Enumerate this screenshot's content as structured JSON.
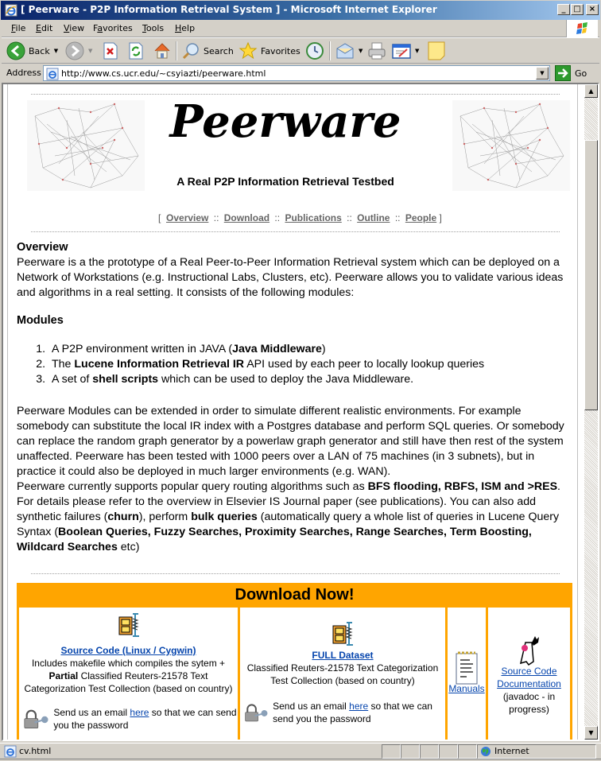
{
  "window": {
    "title": "[ Peerware - P2P Information Retrieval System ] - Microsoft Internet Explorer",
    "minimize": "_",
    "maximize": "□",
    "close": "×"
  },
  "menu": {
    "items": [
      {
        "label": "File",
        "accel": "F"
      },
      {
        "label": "Edit",
        "accel": "E"
      },
      {
        "label": "View",
        "accel": "V"
      },
      {
        "label": "Favorites",
        "accel": "a"
      },
      {
        "label": "Tools",
        "accel": "T"
      },
      {
        "label": "Help",
        "accel": "H"
      }
    ]
  },
  "toolbar": {
    "back_label": "Back",
    "search_label": "Search",
    "favorites_label": "Favorites",
    "icons": [
      "back-icon",
      "forward-icon",
      "stop-icon",
      "refresh-icon",
      "home-icon",
      "search-icon",
      "favorites-star-icon",
      "history-icon",
      "mail-icon",
      "print-icon",
      "edit-icon",
      "notes-icon"
    ]
  },
  "address": {
    "label": "Address",
    "url": "http://www.cs.ucr.edu/~csyiazti/peerware.html",
    "go_label": "Go"
  },
  "page": {
    "title": "Peerware",
    "subtitle": "A Real P2P Information Retrieval Testbed",
    "nav": {
      "open_bracket": "[",
      "close_bracket": "]",
      "separator": "::",
      "links": [
        "Overview",
        "Download",
        "Publications",
        "Outline",
        "People"
      ]
    },
    "overview": {
      "heading": "Overview",
      "text": "Peerware is a the prototype of a Real Peer-to-Peer Information Retrieval system which can be deployed on a Network of Workstations (e.g. Instructional Labs, Clusters, etc). Peerware allows you to validate various ideas and algorithms in a real setting. It consists of the following modules:"
    },
    "modules": {
      "heading": "Modules",
      "items": [
        {
          "pre": "A P2P environment written in JAVA (",
          "bold": "Java Middleware",
          "post": ")"
        },
        {
          "pre": "The ",
          "bold": "Lucene Information Retrieval IR",
          "post": " API used by each peer to locally lookup queries"
        },
        {
          "pre": "A set of ",
          "bold": "shell scripts",
          "post": " which can be used to deploy the Java Middleware."
        }
      ]
    },
    "extend_text": "Peerware Modules can be extended in order to simulate different realistic environments. For example somebody can substitute the local IR index with a Postgres database and perform SQL queries. Or somebody can replace the random graph generator by a powerlaw graph generator and still have then rest of the system unaffected. Peerware has been tested with 1000 peers over a LAN of 75 machines (in 3 subnets), but in practice it could also be deployed in much larger environments (e.g. WAN).",
    "routing": {
      "t1": "Peerware currently supports popular query routing algorithms such as ",
      "b1": "BFS flooding, RBFS, ISM and >RES",
      "t2": ". For details please refer to the overview in Elsevier IS Journal paper (see publications). You can also add synthetic failures (",
      "b2": "churn",
      "t3": "), perform ",
      "b3": "bulk queries",
      "t4": " (automatically query a whole list of queries in Lucene Query Syntax (",
      "b4": "Boolean Queries, Fuzzy Searches, Proximity Searches, Range Searches, Term Boosting, Wildcard Searches",
      "t5": " etc)"
    },
    "download": {
      "heading": "Download Now!",
      "accent_color": "#ffa500",
      "source": {
        "link": "Source Code (Linux / Cygwin)",
        "desc1": "Includes makefile which compiles the sytem +",
        "desc_bold": "Partial",
        "desc2": " Classified Reuters-21578 Text Categorization Test Collection (based on country)",
        "email_pre": "Send us an email ",
        "email_link": "here",
        "email_post": " so that we can send you the password"
      },
      "dataset": {
        "link": "FULL Dataset",
        "desc": "Classified Reuters-21578 Text Categorization Test Collection (based on country)",
        "email_pre": "Send us an email ",
        "email_link": "here",
        "email_post": " so that we can send you the password"
      },
      "manuals": {
        "link": "Manuals"
      },
      "docs": {
        "link1": "Source Code",
        "link2": "Documentation",
        "note": "(javadoc - in progress)"
      }
    }
  },
  "status": {
    "text": "cv.html",
    "zone": "Internet"
  }
}
